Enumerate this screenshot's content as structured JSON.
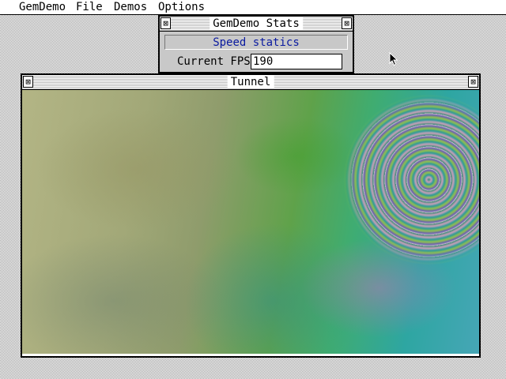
{
  "menubar": {
    "items": [
      {
        "label": "GemDemo"
      },
      {
        "label": "File"
      },
      {
        "label": "Demos"
      },
      {
        "label": "Options"
      }
    ]
  },
  "stats_window": {
    "title": "GemDemo Stats",
    "close_icon": "close-box",
    "fuller_icon": "fuller-box",
    "heading": "Speed statics",
    "fps_label": "Current FPS",
    "fps_value": "190"
  },
  "tunnel_window": {
    "title": "Tunnel",
    "close_icon": "close-box",
    "fuller_icon": "fuller-box"
  },
  "colors": {
    "desktop_pattern": "#9f9f9f",
    "heading_text": "#0a1aa0",
    "dialog_bg": "#c8c8c8"
  }
}
